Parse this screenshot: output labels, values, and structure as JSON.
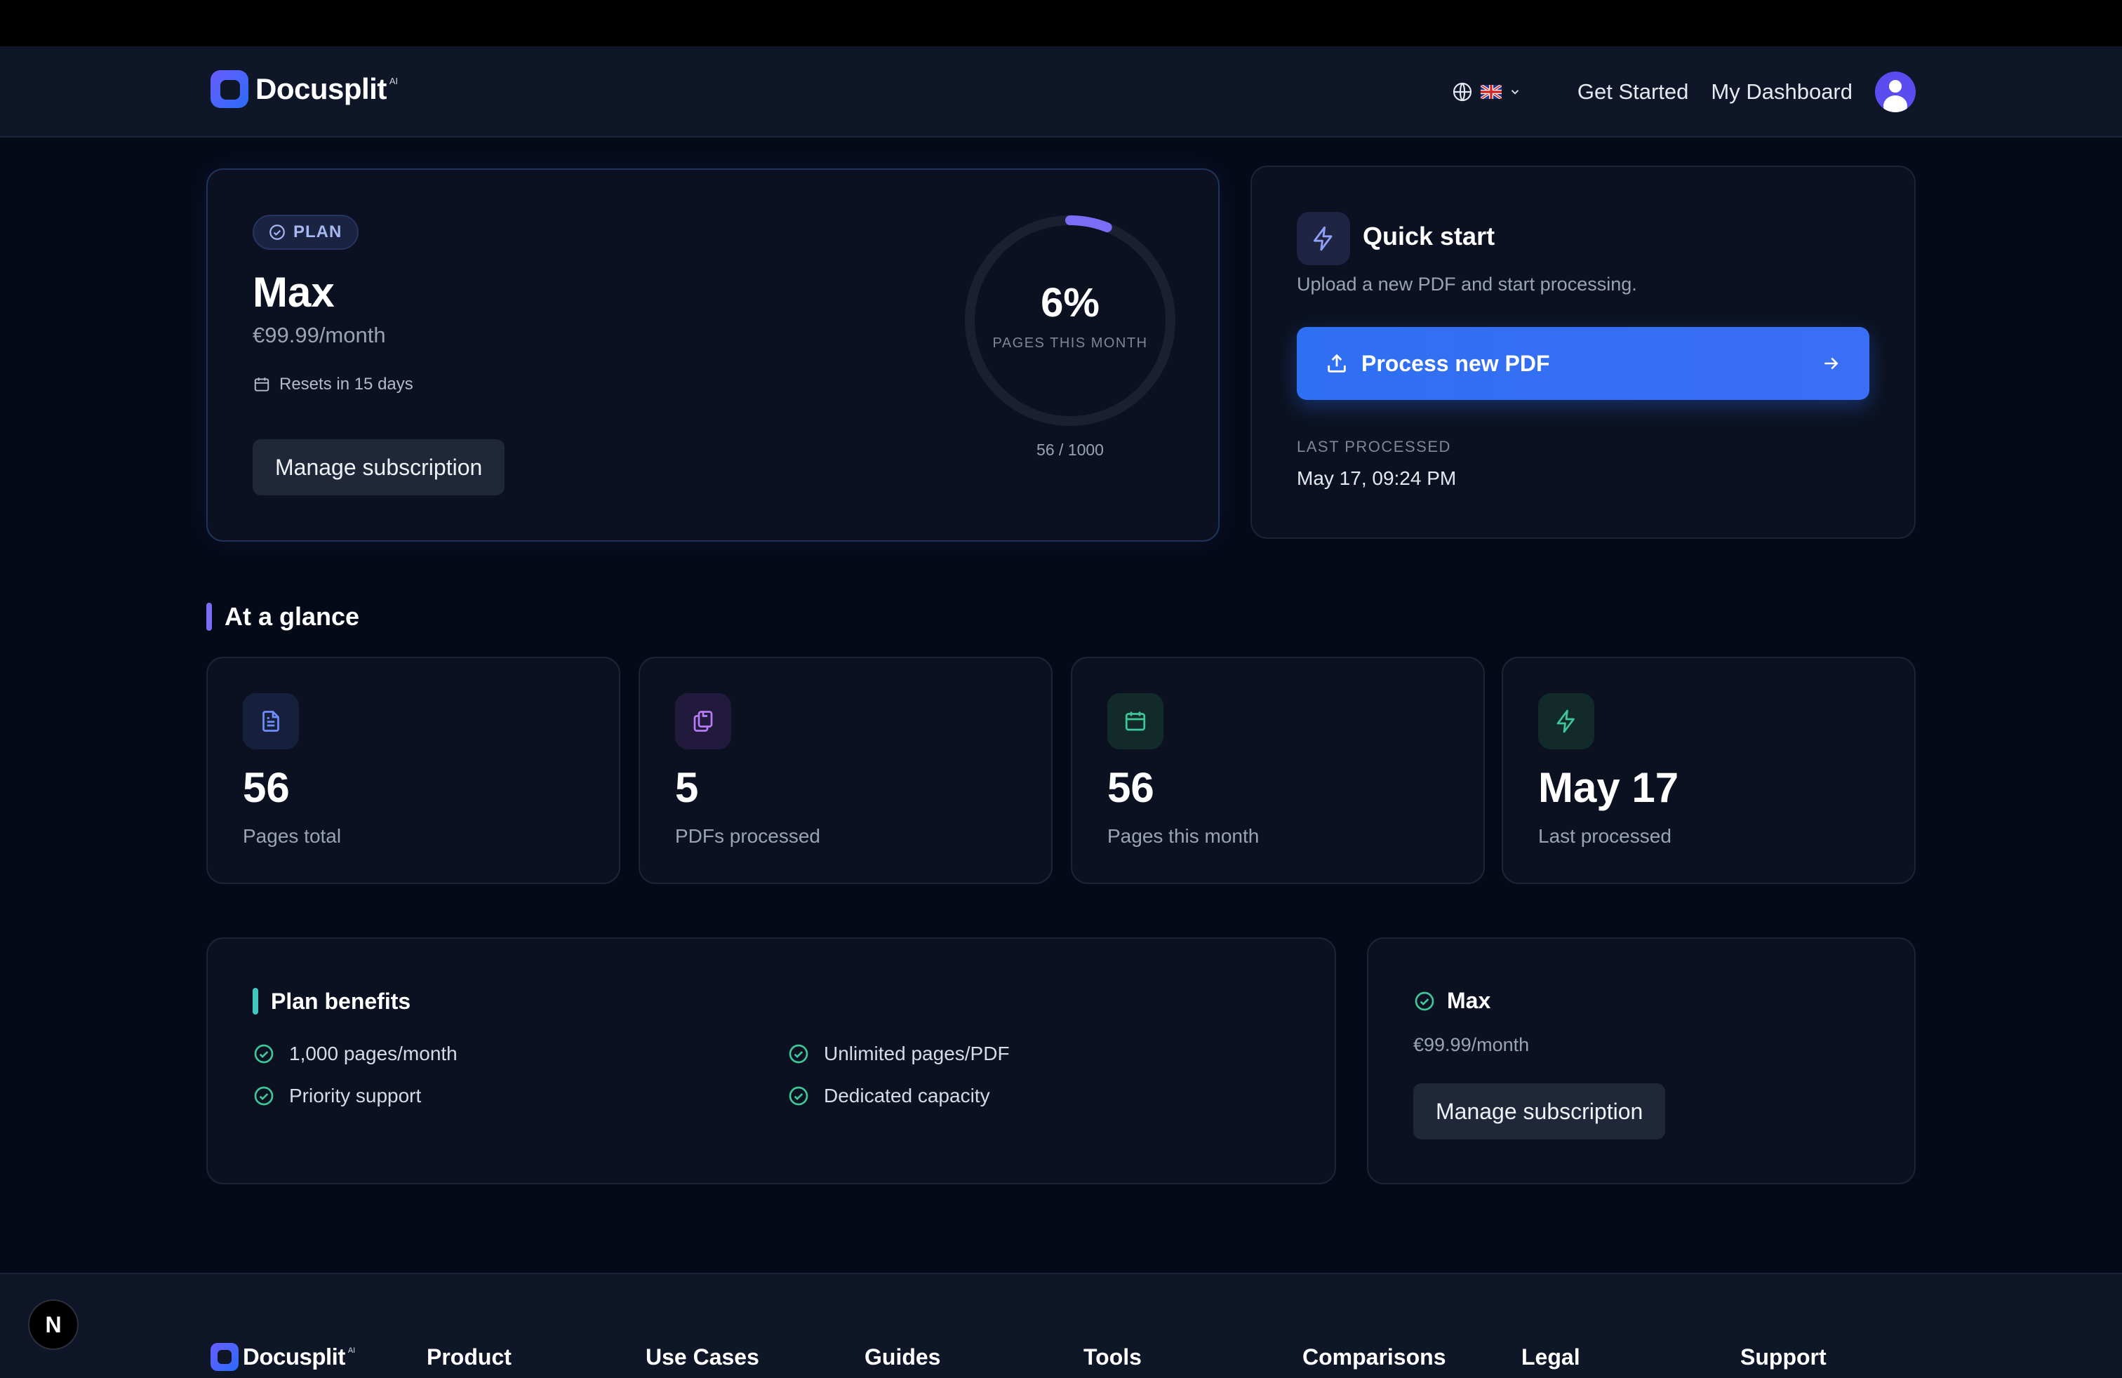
{
  "brand": {
    "name": "Docusplit",
    "superscript": "AI"
  },
  "nav": {
    "language_flag": "UK",
    "get_started": "Get Started",
    "dashboard": "My Dashboard"
  },
  "plan": {
    "badge": "PLAN",
    "name": "Max",
    "price": "€99.99/month",
    "resets": "Resets in 15 days",
    "manage_label": "Manage subscription",
    "usage_percent": "6%",
    "usage_fraction": 0.06,
    "usage_caption": "PAGES THIS MONTH",
    "usage_count": "56 / 1000"
  },
  "quick_start": {
    "title": "Quick start",
    "description": "Upload a new PDF and start processing.",
    "button_label": "Process new PDF",
    "last_processed_label": "LAST PROCESSED",
    "last_processed_value": "May 17, 09:24 PM"
  },
  "glance": {
    "title": "At a glance",
    "stats": [
      {
        "value": "56",
        "label": "Pages total",
        "icon": "document-icon",
        "color": "#6f8ef7"
      },
      {
        "value": "5",
        "label": "PDFs processed",
        "icon": "copy-icon",
        "color": "#b57cf5"
      },
      {
        "value": "56",
        "label": "Pages this month",
        "icon": "calendar-icon",
        "color": "#3fc79a"
      },
      {
        "value": "May 17",
        "label": "Last processed",
        "icon": "bolt-icon",
        "color": "#3fc79a"
      }
    ]
  },
  "benefits": {
    "title": "Plan benefits",
    "items": [
      "1,000 pages/month",
      "Unlimited pages/PDF",
      "Priority support",
      "Dedicated capacity"
    ]
  },
  "mini_plan": {
    "name": "Max",
    "price": "€99.99/month",
    "manage_label": "Manage subscription"
  },
  "footer": {
    "brand": "Docusplit",
    "columns": [
      "Product",
      "Use Cases",
      "Guides",
      "Tools",
      "Comparisons",
      "Legal",
      "Support"
    ]
  },
  "dev_badge": "N",
  "colors": {
    "accent": "#2f6ff2",
    "ring": "#7c6cf6",
    "check": "#3fc79a",
    "background": "#050a18"
  }
}
